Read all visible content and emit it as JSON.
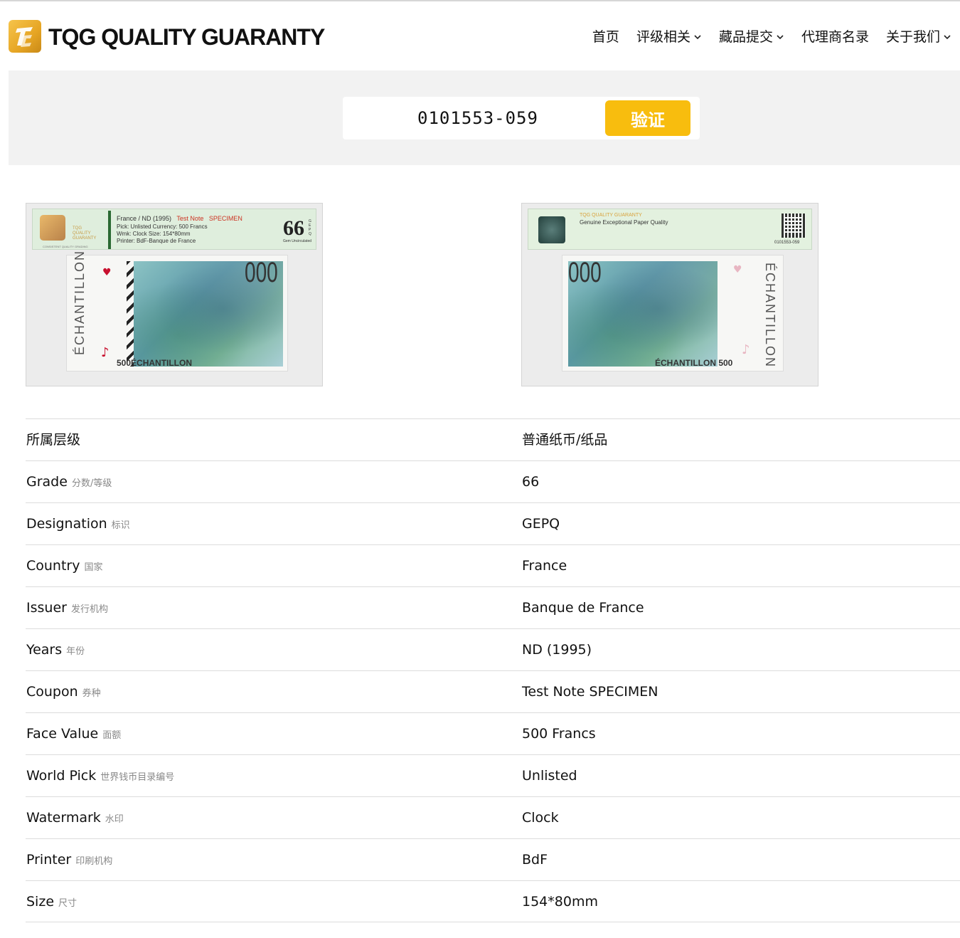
{
  "header": {
    "logo_text": "TQG QUALITY GUARANTY",
    "nav": [
      {
        "label": "首页",
        "dropdown": false
      },
      {
        "label": "评级相关",
        "dropdown": true
      },
      {
        "label": "藏品提交",
        "dropdown": true
      },
      {
        "label": "代理商名录",
        "dropdown": false
      },
      {
        "label": "关于我们",
        "dropdown": true
      }
    ]
  },
  "search": {
    "value": "0101553-059",
    "button_label": "验证"
  },
  "front_label": {
    "logo_lines": [
      "TQG",
      "QUALITY",
      "GUARANTY"
    ],
    "title": "France / ND (1995)",
    "coupon": "Test Note",
    "specimen": "SPECIMEN",
    "line2": "Pick: Unlisted    Currency: 500 Francs",
    "line3": "Wmk: Clock    Size: 154*80mm",
    "line4": "Printer: BdF-Banque de France",
    "grade": "66",
    "grade_desc": "Gem Uncirculated",
    "designation": "GEPQ",
    "footer": "CONSISTENT QUALITY GRADING"
  },
  "back_label": {
    "brand": "TQG QUALITY GUARANTY",
    "tagline": "Genuine Exceptional Paper Quality",
    "cert": "0101553-059"
  },
  "note": {
    "echantillon": "ÉCHANTILLON",
    "number": "000",
    "front_bottom": "500ÉCHANTILLON",
    "back_bottom": "ÉCHANTILLON 500"
  },
  "details": [
    {
      "key": "所属层级",
      "key_zh": "",
      "value": "普通纸币/纸品"
    },
    {
      "key": "Grade",
      "key_zh": "分数/等级",
      "value": "66"
    },
    {
      "key": "Designation",
      "key_zh": "标识",
      "value": "GEPQ"
    },
    {
      "key": "Country",
      "key_zh": "国家",
      "value": "France"
    },
    {
      "key": "Issuer",
      "key_zh": "发行机构",
      "value": "Banque de France"
    },
    {
      "key": "Years",
      "key_zh": "年份",
      "value": "ND (1995)"
    },
    {
      "key": "Coupon",
      "key_zh": "券种",
      "value": "Test Note SPECIMEN"
    },
    {
      "key": "Face Value",
      "key_zh": "面额",
      "value": "500 Francs"
    },
    {
      "key": "World Pick",
      "key_zh": "世界钱币目录编号",
      "value": "Unlisted"
    },
    {
      "key": "Watermark",
      "key_zh": "水印",
      "value": "Clock"
    },
    {
      "key": "Printer",
      "key_zh": "印刷机构",
      "value": "BdF"
    },
    {
      "key": "Size",
      "key_zh": "尺寸",
      "value": "154*80mm"
    }
  ]
}
